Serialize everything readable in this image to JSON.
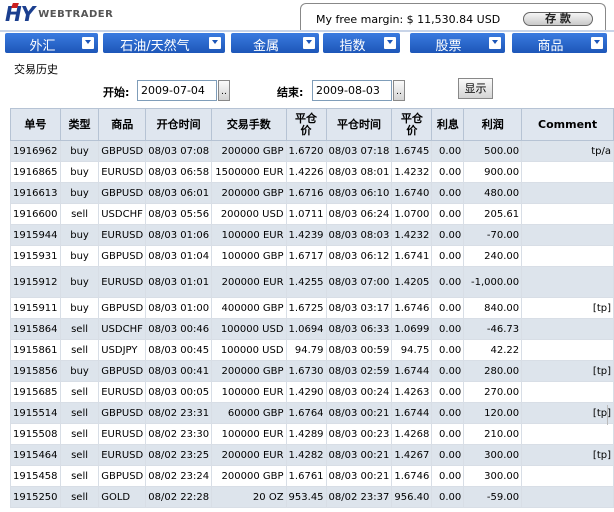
{
  "header": {
    "logo_main": "HY",
    "logo_sub": "WEBTRADER",
    "margin_text": "My free margin: $ 11,530.84 USD",
    "deposit_label": "存 款"
  },
  "nav": [
    {
      "label": "外汇"
    },
    {
      "label": "石油/天然气"
    },
    {
      "label": "金属"
    },
    {
      "label": "指数"
    },
    {
      "label": "股票"
    },
    {
      "label": "商品"
    }
  ],
  "page": {
    "title": "交易历史",
    "start_label": "开始:",
    "start_value": "2009-07-04",
    "end_label": "结束:",
    "end_value": "2009-08-03",
    "picker_label": "..",
    "show_label": "显示"
  },
  "table": {
    "headers": [
      "单号",
      "类型",
      "商品",
      "开仓时间",
      "交易手数",
      "平仓\n价",
      "平仓时间",
      "平仓\n价",
      "利息",
      "利润",
      "Comment"
    ],
    "rows": [
      [
        "1916962",
        "buy",
        "GBPUSD",
        "08/03 07:08",
        "200000 GBP",
        "1.6720",
        "08/03 07:18",
        "1.6745",
        "0.00",
        "500.00",
        "tp/a"
      ],
      [
        "1916865",
        "buy",
        "EURUSD",
        "08/03 06:58",
        "1500000 EUR",
        "1.4226",
        "08/03 08:01",
        "1.4232",
        "0.00",
        "900.00",
        ""
      ],
      [
        "1916613",
        "buy",
        "GBPUSD",
        "08/03 06:01",
        "200000 GBP",
        "1.6716",
        "08/03 06:10",
        "1.6740",
        "0.00",
        "480.00",
        ""
      ],
      [
        "1916600",
        "sell",
        "USDCHF",
        "08/03 05:56",
        "200000 USD",
        "1.0711",
        "08/03 06:24",
        "1.0700",
        "0.00",
        "205.61",
        ""
      ],
      [
        "1915944",
        "buy",
        "EURUSD",
        "08/03 01:06",
        "100000 EUR",
        "1.4239",
        "08/03 08:03",
        "1.4232",
        "0.00",
        "-70.00",
        ""
      ],
      [
        "1915931",
        "buy",
        "GBPUSD",
        "08/03 01:04",
        "100000 GBP",
        "1.6717",
        "08/03 06:12",
        "1.6741",
        "0.00",
        "240.00",
        ""
      ],
      [
        "1915912",
        "buy",
        "EURUSD",
        "08/03 01:01",
        "200000 EUR",
        "1.4255",
        "08/03 07:00",
        "1.4205",
        "0.00",
        "-1,000.00",
        ""
      ],
      [
        "1915911",
        "buy",
        "GBPUSD",
        "08/03 01:00",
        "400000 GBP",
        "1.6725",
        "08/03 03:17",
        "1.6746",
        "0.00",
        "840.00",
        "[tp]"
      ],
      [
        "1915864",
        "sell",
        "USDCHF",
        "08/03 00:46",
        "100000 USD",
        "1.0694",
        "08/03 06:33",
        "1.0699",
        "0.00",
        "-46.73",
        ""
      ],
      [
        "1915861",
        "sell",
        "USDJPY",
        "08/03 00:45",
        "100000 USD",
        "94.79",
        "08/03 00:59",
        "94.75",
        "0.00",
        "42.22",
        ""
      ],
      [
        "1915856",
        "buy",
        "GBPUSD",
        "08/03 00:41",
        "200000 GBP",
        "1.6730",
        "08/03 02:59",
        "1.6744",
        "0.00",
        "280.00",
        "[tp]"
      ],
      [
        "1915685",
        "sell",
        "EURUSD",
        "08/03 00:05",
        "100000 EUR",
        "1.4290",
        "08/03 00:24",
        "1.4263",
        "0.00",
        "270.00",
        ""
      ],
      [
        "1915514",
        "sell",
        "GBPUSD",
        "08/02 23:31",
        "60000 GBP",
        "1.6764",
        "08/03 00:21",
        "1.6744",
        "0.00",
        "120.00",
        "[tp]"
      ],
      [
        "1915508",
        "sell",
        "EURUSD",
        "08/02 23:30",
        "100000 EUR",
        "1.4289",
        "08/03 00:23",
        "1.4268",
        "0.00",
        "210.00",
        ""
      ],
      [
        "1915464",
        "sell",
        "EURUSD",
        "08/02 23:25",
        "200000 EUR",
        "1.4282",
        "08/03 00:21",
        "1.4267",
        "0.00",
        "300.00",
        "[tp]"
      ],
      [
        "1915458",
        "sell",
        "GBPUSD",
        "08/02 23:24",
        "200000 GBP",
        "1.6761",
        "08/03 00:21",
        "1.6746",
        "0.00",
        "300.00",
        ""
      ],
      [
        "1915250",
        "sell",
        "GOLD",
        "08/02 22:28",
        "20 OZ",
        "953.45",
        "08/02 23:37",
        "956.40",
        "0.00",
        "-59.00",
        ""
      ]
    ]
  },
  "colors": {
    "nav_tab": "#2565c8",
    "header_bg": "#dfe6ef",
    "row_alt": "#dde4ec"
  }
}
